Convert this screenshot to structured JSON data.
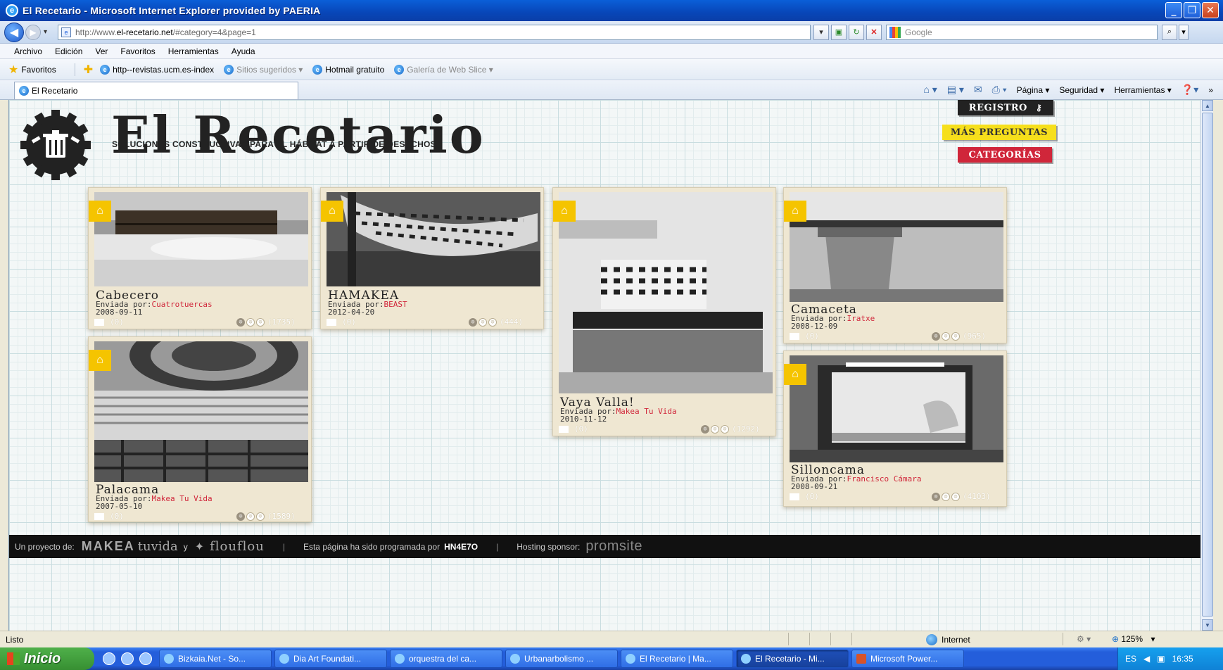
{
  "window": {
    "title": "El Recetario - Microsoft Internet Explorer provided by PAERIA"
  },
  "address_bar": {
    "url_prefix": "http://www.",
    "url_host": "el-recetario.net",
    "url_rest": "/#category=4&page=1",
    "search_placeholder": "Google"
  },
  "menu": [
    "Archivo",
    "Edición",
    "Ver",
    "Favoritos",
    "Herramientas",
    "Ayuda"
  ],
  "favorites_bar": {
    "favorites_label": "Favoritos",
    "items": [
      {
        "label": "http--revistas.ucm.es-index",
        "dim": false
      },
      {
        "label": "Sitios sugeridos ▾",
        "dim": true
      },
      {
        "label": "Hotmail gratuito",
        "dim": false
      },
      {
        "label": "Galería de Web Slice ▾",
        "dim": true
      }
    ]
  },
  "tab": {
    "label": "El Recetario"
  },
  "command_bar": {
    "page": "Página ▾",
    "security": "Seguridad ▾",
    "tools": "Herramientas ▾"
  },
  "site": {
    "title": "El Recetario",
    "subtitle": "SOLUCIONES CONSTRUCTIVAS PARA EL HÁBITAT A PARTIR DE DESECHOS",
    "buttons": {
      "registro": "REGISTRO",
      "preguntas": "MÁS PREGUNTAS",
      "categorias": "CATEGORÍAS"
    },
    "by_prefix": "Enviada por:",
    "cards": [
      {
        "title": "Cabecero",
        "author": "Cuatrotuercas",
        "date": "2008-09-11",
        "comments": "(0)",
        "votes": "(1735)"
      },
      {
        "title": "HAMAKEA",
        "author": "BEAST",
        "date": "2012-04-20",
        "comments": "(0)",
        "votes": "(444)"
      },
      {
        "title": "Vaya Valla!",
        "author": "Makea Tu Vida",
        "date": "2010-11-12",
        "comments": "(0)",
        "votes": "(1292)"
      },
      {
        "title": "Camaceta",
        "author": "Iratxe",
        "date": "2008-12-09",
        "comments": "(0)",
        "votes": "(965)"
      },
      {
        "title": "Palacama",
        "author": "Makea Tu Vida",
        "date": "2007-05-10",
        "comments": "(0)",
        "votes": "(1589)"
      },
      {
        "title": "Silloncama",
        "author": "Francisco Cámara",
        "date": "2008-09-21",
        "comments": "(0)",
        "votes": "(4103)"
      }
    ],
    "footer": {
      "project": "Un proyecto de:",
      "makea": "MAKEA",
      "tuvida": "tuvida",
      "y": "y",
      "flouflou": "flouflou",
      "programmed": "Esta página ha sido programada por",
      "hn": "HN4E7O",
      "hosting": "Hosting sponsor:",
      "promsite": "promsite"
    }
  },
  "status_bar": {
    "status": "Listo",
    "zone": "Internet",
    "zoom": "125%"
  },
  "taskbar": {
    "start": "Inicio",
    "tasks": [
      {
        "label": "Bizkaia.Net - So...",
        "active": false
      },
      {
        "label": "Dia Art Foundati...",
        "active": false
      },
      {
        "label": "orquestra del ca...",
        "active": false
      },
      {
        "label": "Urbanarbolismo ...",
        "active": false
      },
      {
        "label": "El Recetario | Ma...",
        "active": false
      },
      {
        "label": "El Recetario - Mi...",
        "active": true
      },
      {
        "label": "Microsoft Power...",
        "active": false
      }
    ],
    "lang": "ES",
    "time": "16:35"
  },
  "colors": {
    "accent_red": "#d0263a",
    "accent_yellow": "#f6df1c",
    "badge_yellow": "#f5c400",
    "card_bg": "#efe7d2",
    "xp_blue": "#245edb"
  }
}
